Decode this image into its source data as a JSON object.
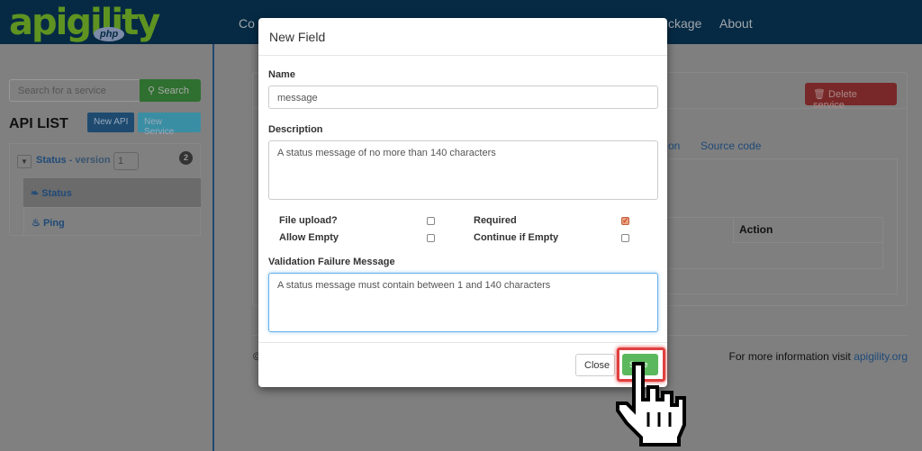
{
  "navbar": {
    "logo": "apigility",
    "logo_badge": "php",
    "links": [
      "Co",
      "ckage",
      "About"
    ]
  },
  "sidebar": {
    "search_placeholder": "Search for a service",
    "search_button": "Search",
    "title": "API LIST",
    "new_api": "New API",
    "new_service": "New Service",
    "api": {
      "name": "Status",
      "version_label": "- version",
      "version": "1",
      "count": "2"
    },
    "services": [
      {
        "name": "Status",
        "icon": "leaf-icon"
      },
      {
        "name": "Ping",
        "icon": "fire-icon"
      }
    ]
  },
  "main": {
    "delete_button": "Delete service",
    "tab_partial": "on",
    "tab_source": "Source code",
    "table_header": "Action",
    "footer_symbol": "©",
    "footer_text": "For more information visit ",
    "footer_link": "apigility.org"
  },
  "modal": {
    "title": "New Field",
    "name_label": "Name",
    "name_value": "message",
    "description_label": "Description",
    "description_value": "A status message of no more than 140 characters",
    "checkboxes": [
      {
        "label": "File upload?",
        "checked": false
      },
      {
        "label": "Required",
        "checked": true
      },
      {
        "label": "Allow Empty",
        "checked": false
      },
      {
        "label": "Continue if Empty",
        "checked": false
      }
    ],
    "validation_label": "Validation Failure Message",
    "validation_value": "A status message must contain between 1 and 140 characters",
    "close": "Close",
    "save": "Save"
  },
  "colors": {
    "accent_green": "#5cb85c",
    "highlight": "#e04040",
    "check": "#e06a3a"
  }
}
